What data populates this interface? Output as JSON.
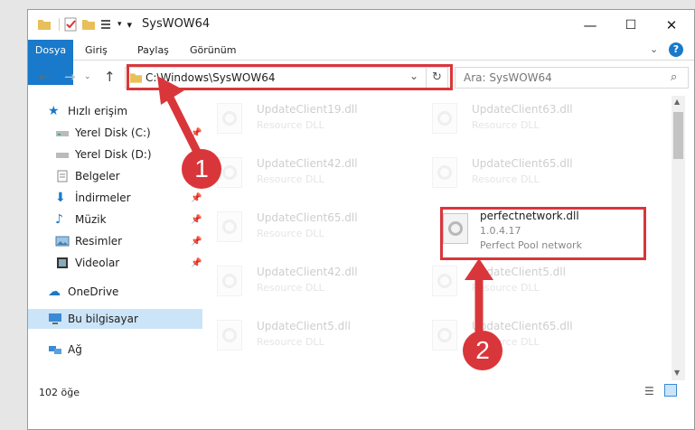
{
  "window": {
    "title": "SysWOW64",
    "controls": {
      "minimize": "—",
      "maximize": "☐",
      "close": "✕"
    }
  },
  "ribbon": {
    "tabs": [
      "Dosya",
      "Giriş",
      "Paylaş",
      "Görünüm"
    ]
  },
  "address_bar": {
    "path": "C:\\Windows\\SysWOW64",
    "search_placeholder": "Ara: SysWOW64"
  },
  "sidebar": {
    "quick_access": "Hızlı erişim",
    "items": [
      {
        "label": "Yerel Disk (C:)",
        "pinned": true
      },
      {
        "label": "Yerel Disk (D:)",
        "pinned": false
      },
      {
        "label": "Belgeler",
        "pinned": true
      },
      {
        "label": "İndirmeler",
        "pinned": true
      },
      {
        "label": "Müzik",
        "pinned": true
      },
      {
        "label": "Resimler",
        "pinned": true
      },
      {
        "label": "Videolar",
        "pinned": true
      }
    ],
    "onedrive": "OneDrive",
    "this_pc": "Bu bilgisayar",
    "network": "Ağ"
  },
  "files": {
    "left_column": [
      {
        "name": "UpdateClient19.dll",
        "type": "Resource DLL"
      },
      {
        "name": "UpdateClient42.dll",
        "type": "Resource DLL"
      },
      {
        "name": "UpdateClient65.dll",
        "type": "Resource DLL"
      },
      {
        "name": "UpdateClient42.dll",
        "type": "Resource DLL"
      },
      {
        "name": "UpdateClient5.dll",
        "type": "Resource DLL"
      }
    ],
    "right_column": [
      {
        "name": "UpdateClient63.dll",
        "type": "Resource DLL"
      },
      {
        "name": "UpdateClient65.dll",
        "type": "Resource DLL"
      },
      {
        "name": "perfectnetwork.dll",
        "version": "1.0.4.17",
        "description": "Perfect Pool network"
      },
      {
        "name": "UpdateClient5.dll",
        "type": "Resource DLL"
      },
      {
        "name": "UpdateClient65.dll",
        "type": "Resource DLL"
      }
    ]
  },
  "status_bar": {
    "item_count": "102 öğe"
  },
  "annotations": {
    "step1": "1",
    "step2": "2",
    "color": "#d9363b"
  }
}
